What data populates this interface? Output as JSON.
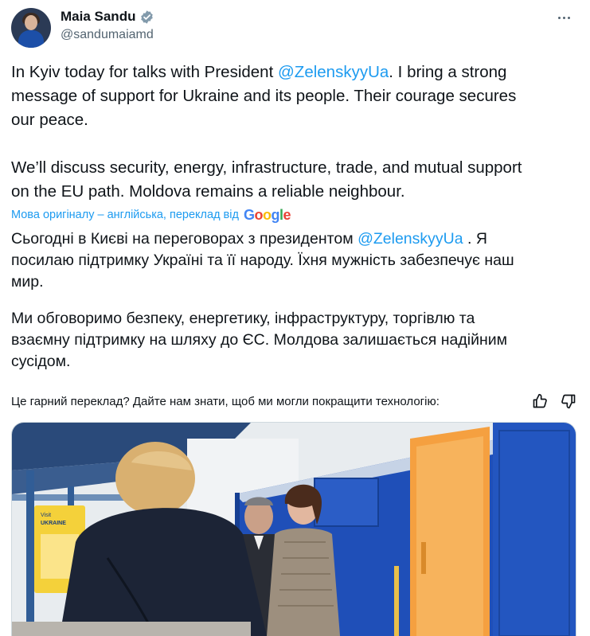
{
  "author": {
    "name": "Maia Sandu",
    "handle": "@sandumaiamd"
  },
  "tweet": {
    "p1_part1": "In Kyiv today for talks with President ",
    "p1_mention": "@ZelenskyyUa",
    "p1_line1_rest": ". I bring a strong",
    "p1_line2": "message of support for Ukraine and its people. Their courage secures",
    "p1_line3": "our peace.",
    "p2_line1": "We’ll discuss security, energy, infrastructure, trade, and mutual support",
    "p2_line2": "on the EU path. Moldova remains a reliable neighbour."
  },
  "translation": {
    "note": "Мова оригіналу – англійська, переклад від",
    "provider": "Google",
    "t1_part1": "Сьогодні в Києві на переговорах з президентом ",
    "t1_mention": "@ZelenskyyUa",
    "t1_line1_rest": " . Я",
    "t1_line2": "посилаю підтримку Україні та її народу. Їхня мужність забезпечує наш",
    "t1_line3": "мир.",
    "t2_line1": "Ми обговоримо безпеку, енергетику, інфраструктуру, торгівлю та",
    "t2_line2": "взаємну підтримку на шляху до ЄС. Молдова залишається надійним",
    "t2_line3": "сусідом.",
    "feedback_question": "Це гарний переклад? Дайте нам знати, щоб ми могли покращити технологію:"
  },
  "media": {
    "sign_small": "Visit",
    "sign_big": "UKRAINE"
  },
  "colors": {
    "accent": "#1d9bf0",
    "text": "#0f1419",
    "secondary": "#536471",
    "train_blue": "#1f4fb8",
    "door_orange": "#f5a040"
  }
}
